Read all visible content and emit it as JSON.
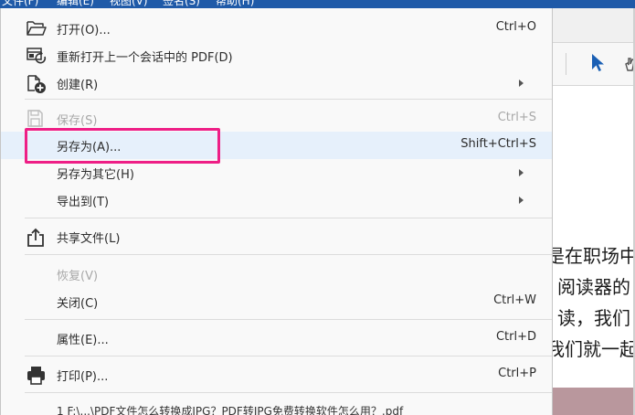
{
  "menubar": {
    "items": [
      "文件(F)",
      "编辑(E)",
      "视图(V)",
      "签名(S)",
      "帮助(H)"
    ]
  },
  "menu": {
    "open": {
      "label": "打开(O)...",
      "shortcut": "Ctrl+O",
      "icon": "folder-open-icon"
    },
    "reopen": {
      "label": "重新打开上一个会话中的 PDF(D)",
      "icon": "reopen-session-icon"
    },
    "create": {
      "label": "创建(R)",
      "icon": "create-pdf-icon"
    },
    "save": {
      "label": "保存(S)",
      "shortcut": "Ctrl+S",
      "icon": "save-icon",
      "disabled": true
    },
    "save_as": {
      "label": "另存为(A)...",
      "shortcut": "Shift+Ctrl+S"
    },
    "save_as_other": {
      "label": "另存为其它(H)"
    },
    "export_to": {
      "label": "导出到(T)"
    },
    "share": {
      "label": "共享文件(L)",
      "icon": "share-icon"
    },
    "revert": {
      "label": "恢复(V)",
      "disabled": true
    },
    "close": {
      "label": "关闭(C)",
      "shortcut": "Ctrl+W"
    },
    "properties": {
      "label": "属性(E)...",
      "shortcut": "Ctrl+D"
    },
    "print": {
      "label": "打印(P)...",
      "shortcut": "Ctrl+P",
      "icon": "print-icon"
    },
    "recent": {
      "label": "1 F:\\...\\PDF文件怎么转换成JPG？PDF转JPG免费转换软件怎么用？.pdf"
    }
  },
  "document": {
    "lines": [
      "是在职场中",
      "阅读器的",
      "读，我们",
      "我们就一起"
    ]
  },
  "colors": {
    "highlight": "#ee1f86",
    "hover": "#e6f0fb",
    "accent": "#1f5aa8"
  }
}
